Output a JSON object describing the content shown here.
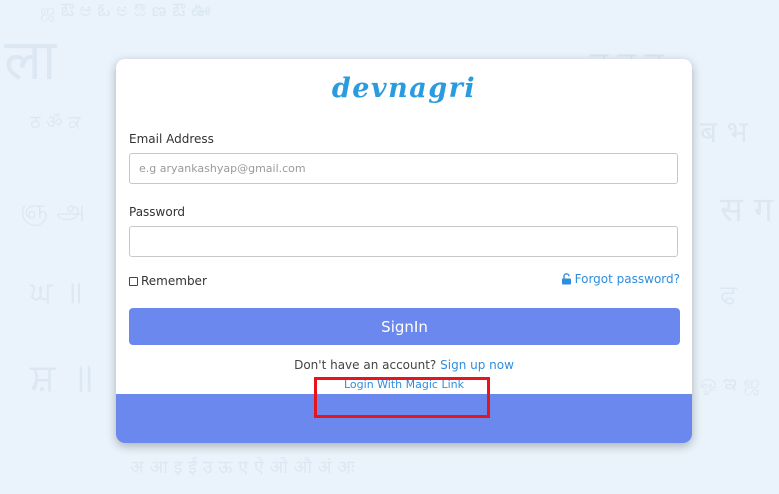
{
  "colors": {
    "accent": "#6a88ee",
    "link": "#2f8de0",
    "logo": "#2b9be0",
    "highlight": "#e8141c",
    "background": "#eaf3fb"
  },
  "brand": {
    "logo_text": "devnagri"
  },
  "form": {
    "email_label": "Email Address",
    "email_placeholder": "e.g aryankashyap@gmail.com",
    "email_value": "",
    "password_label": "Password",
    "password_value": "",
    "remember_label": "Remember",
    "remember_checked": false,
    "forgot_label": "Forgot password?",
    "forgot_icon": "unlock-icon",
    "signin_label": "SignIn"
  },
  "signup": {
    "prompt": "Don't have an account?",
    "link": "Sign up now"
  },
  "magic_link": {
    "label": "Login With Magic Link"
  }
}
